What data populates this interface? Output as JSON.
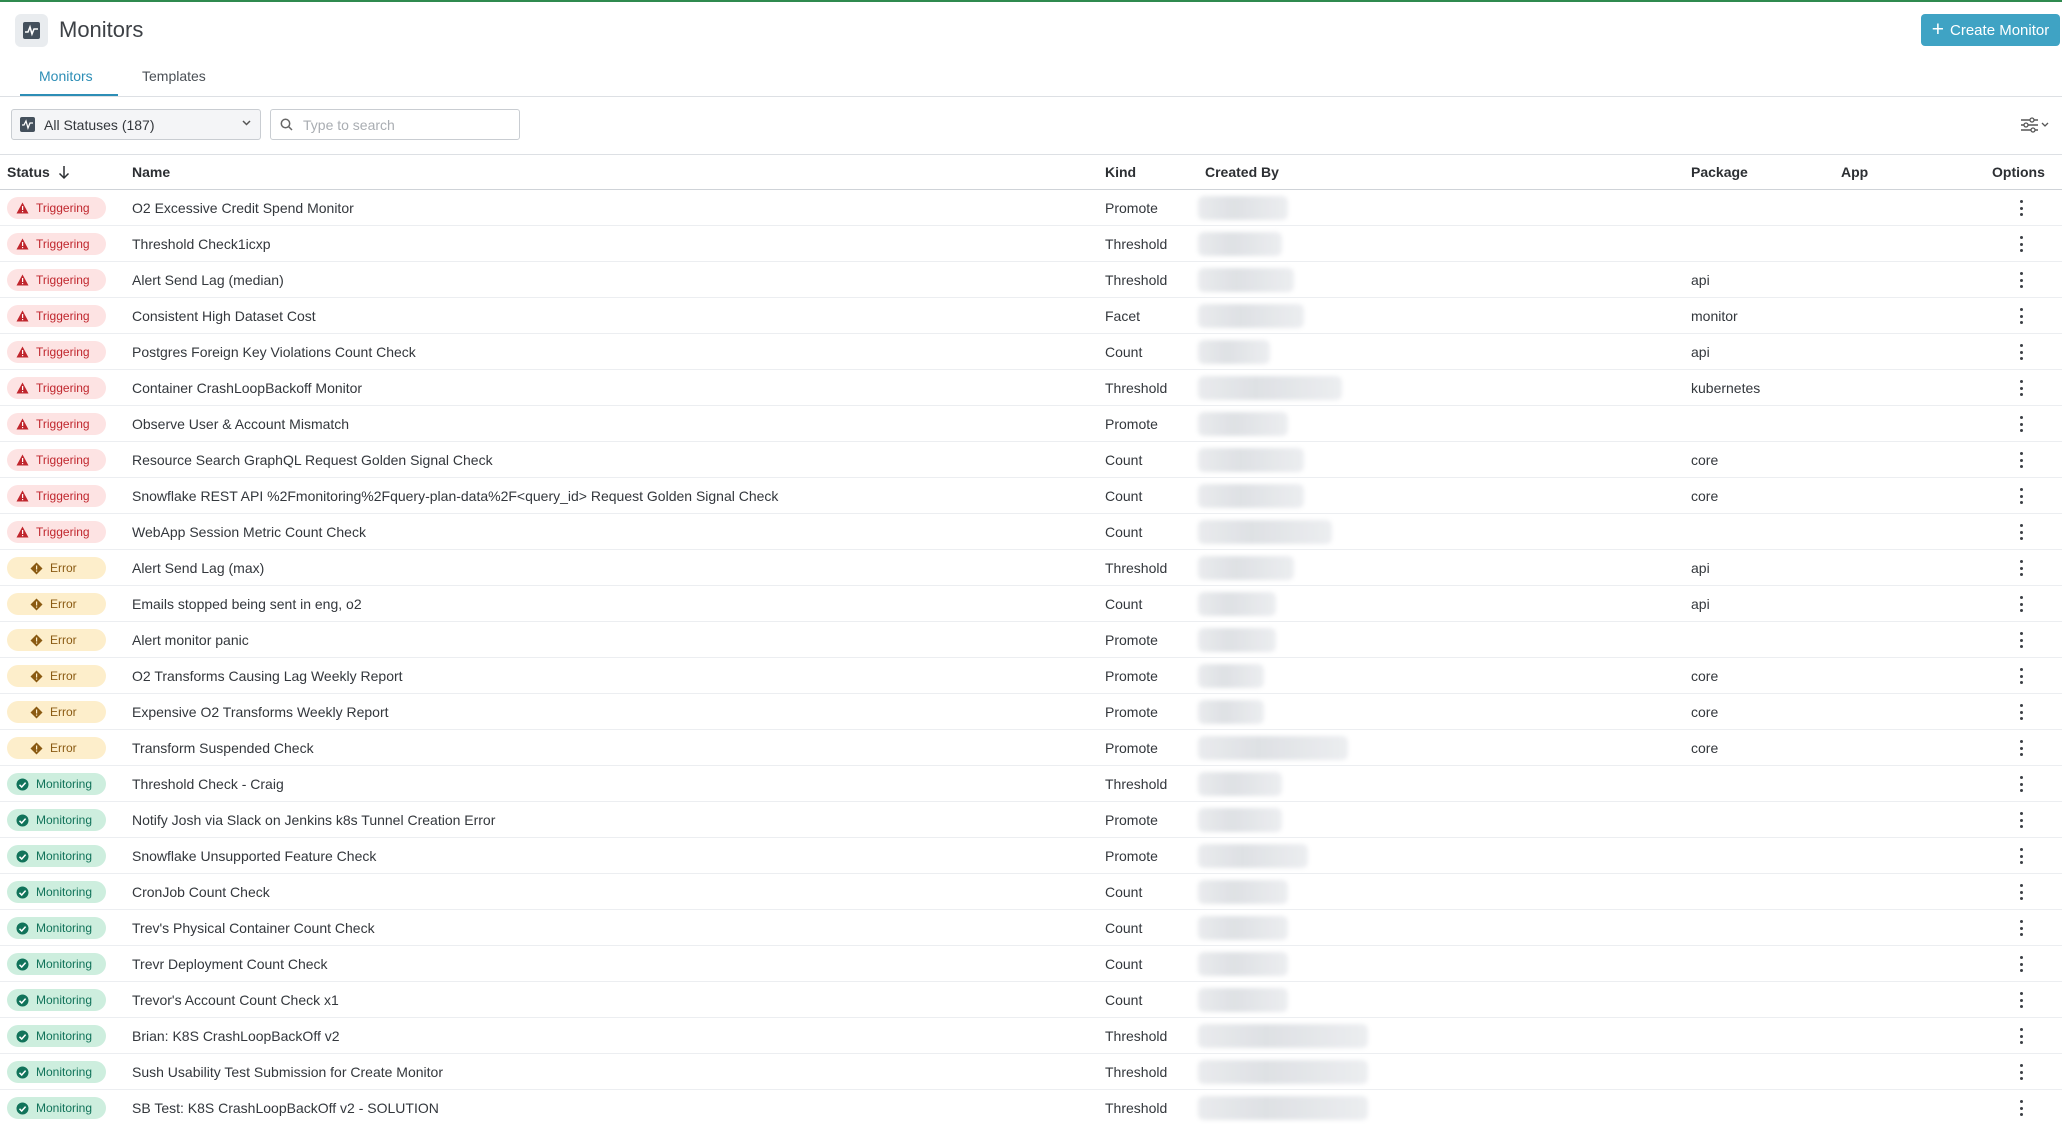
{
  "header": {
    "title": "Monitors",
    "create_label": "Create Monitor"
  },
  "tabs": [
    {
      "label": "Monitors",
      "active": true
    },
    {
      "label": "Templates",
      "active": false
    }
  ],
  "filters": {
    "status_select": "All Statuses (187)",
    "search_placeholder": "Type to search"
  },
  "table": {
    "columns": [
      "Status",
      "Name",
      "Kind",
      "Created By",
      "Package",
      "App",
      "Options"
    ],
    "rows": [
      {
        "status": "Triggering",
        "name": "O2 Excessive Credit Spend Monitor",
        "kind": "Promote",
        "package": "",
        "app": ""
      },
      {
        "status": "Triggering",
        "name": "Threshold Check1icxp",
        "kind": "Threshold",
        "package": "",
        "app": ""
      },
      {
        "status": "Triggering",
        "name": "Alert Send Lag (median)",
        "kind": "Threshold",
        "package": "api",
        "app": ""
      },
      {
        "status": "Triggering",
        "name": "Consistent High Dataset Cost",
        "kind": "Facet",
        "package": "monitor",
        "app": ""
      },
      {
        "status": "Triggering",
        "name": "Postgres Foreign Key Violations Count Check",
        "kind": "Count",
        "package": "api",
        "app": ""
      },
      {
        "status": "Triggering",
        "name": "Container CrashLoopBackoff Monitor",
        "kind": "Threshold",
        "package": "kubernetes",
        "app": ""
      },
      {
        "status": "Triggering",
        "name": "Observe User & Account Mismatch",
        "kind": "Promote",
        "package": "",
        "app": ""
      },
      {
        "status": "Triggering",
        "name": "Resource Search GraphQL Request Golden Signal Check",
        "kind": "Count",
        "package": "core",
        "app": ""
      },
      {
        "status": "Triggering",
        "name": "Snowflake REST API %2Fmonitoring%2Fquery-plan-data%2F<query_id> Request Golden Signal Check",
        "kind": "Count",
        "package": "core",
        "app": ""
      },
      {
        "status": "Triggering",
        "name": "WebApp Session Metric Count Check",
        "kind": "Count",
        "package": "",
        "app": ""
      },
      {
        "status": "Error",
        "name": "Alert Send Lag (max)",
        "kind": "Threshold",
        "package": "api",
        "app": ""
      },
      {
        "status": "Error",
        "name": "Emails stopped being sent in eng, o2",
        "kind": "Count",
        "package": "api",
        "app": ""
      },
      {
        "status": "Error",
        "name": "Alert monitor panic",
        "kind": "Promote",
        "package": "",
        "app": ""
      },
      {
        "status": "Error",
        "name": "O2 Transforms Causing Lag Weekly Report",
        "kind": "Promote",
        "package": "core",
        "app": ""
      },
      {
        "status": "Error",
        "name": "Expensive O2 Transforms Weekly Report",
        "kind": "Promote",
        "package": "core",
        "app": ""
      },
      {
        "status": "Error",
        "name": "Transform Suspended Check",
        "kind": "Promote",
        "package": "core",
        "app": ""
      },
      {
        "status": "Monitoring",
        "name": "Threshold Check - Craig",
        "kind": "Threshold",
        "package": "",
        "app": ""
      },
      {
        "status": "Monitoring",
        "name": "Notify Josh via Slack on Jenkins k8s Tunnel Creation Error",
        "kind": "Promote",
        "package": "",
        "app": ""
      },
      {
        "status": "Monitoring",
        "name": "Snowflake Unsupported Feature Check",
        "kind": "Promote",
        "package": "",
        "app": ""
      },
      {
        "status": "Monitoring",
        "name": "CronJob Count Check",
        "kind": "Count",
        "package": "",
        "app": ""
      },
      {
        "status": "Monitoring",
        "name": "Trev's Physical Container Count Check",
        "kind": "Count",
        "package": "",
        "app": ""
      },
      {
        "status": "Monitoring",
        "name": "Trevr Deployment Count Check",
        "kind": "Count",
        "package": "",
        "app": ""
      },
      {
        "status": "Monitoring",
        "name": "Trevor's Account Count Check x1",
        "kind": "Count",
        "package": "",
        "app": ""
      },
      {
        "status": "Monitoring",
        "name": "Brian: K8S CrashLoopBackOff v2",
        "kind": "Threshold",
        "package": "",
        "app": ""
      },
      {
        "status": "Monitoring",
        "name": "Sush Usability Test Submission for Create Monitor",
        "kind": "Threshold",
        "package": "",
        "app": ""
      },
      {
        "status": "Monitoring",
        "name": "SB Test: K8S CrashLoopBackOff v2 - SOLUTION",
        "kind": "Threshold",
        "package": "",
        "app": ""
      }
    ]
  },
  "icons": {
    "app": "monitor-pulse-icon",
    "create": "plus-icon",
    "status_select": "pulse-icon",
    "dropdown": "chevron-down-icon",
    "search": "search-icon",
    "settings": "sliders-icon",
    "sort": "arrow-down-icon",
    "triggering": "warning-triangle-icon",
    "error": "diamond-alert-icon",
    "monitoring": "check-circle-icon",
    "options": "kebab-menu-icon"
  },
  "colors": {
    "accent": "#3fa3c4",
    "triggering_bg": "#fde3e3",
    "triggering_fg": "#c0262d",
    "error_bg": "#fdeecb",
    "error_fg": "#8a5a12",
    "monitoring_bg": "#cdeede",
    "monitoring_fg": "#11735a"
  }
}
